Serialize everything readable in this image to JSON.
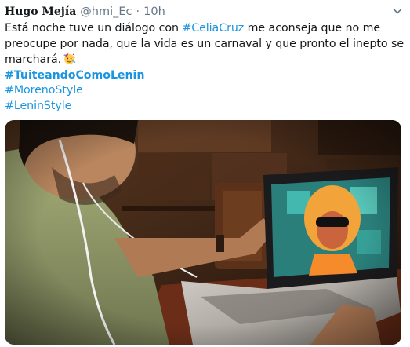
{
  "author": {
    "display_name": "Hugo Mejía",
    "handle": "@hmi_Ec",
    "separator": "·",
    "timestamp": "10h"
  },
  "tweet": {
    "text_line1_before": "Está noche tuve un diálogo con ",
    "hashtag_celia": "#CeliaCruz",
    "text_line1_after": " me aconseja que no me",
    "text_line2": "preocupe por nada, que la vida es un carnaval y que pronto el inepto se",
    "text_line3": "marchará.",
    "hashtags": [
      "#TuiteandoComoLenin",
      "#MorenoStyle",
      "#LeninStyle"
    ]
  },
  "icons": {
    "caret": "chevron-down-icon",
    "emoji": "partying-face-icon"
  },
  "colors": {
    "link": "#1b95e0",
    "muted": "#657786",
    "text": "#14171a"
  },
  "media": {
    "description_icon": "photo"
  }
}
